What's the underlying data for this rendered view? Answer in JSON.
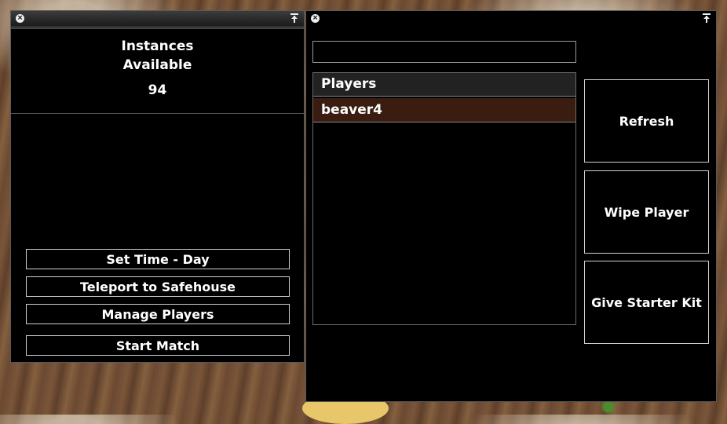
{
  "left_panel": {
    "instances_line1": "Instances",
    "instances_line2": "Available",
    "instances_count": "94",
    "buttons": {
      "set_time": "Set Time - Day",
      "teleport": "Teleport to Safehouse",
      "manage_players": "Manage Players",
      "start_match": "Start Match"
    }
  },
  "right_panel": {
    "search_value": "",
    "players_header": "Players",
    "players": [
      "beaver4"
    ],
    "actions": {
      "refresh": "Refresh",
      "wipe_player": "Wipe Player",
      "give_starter_kit": "Give Starter Kit"
    }
  },
  "icons": {
    "close": "close-icon",
    "pin": "pin-icon"
  },
  "colors": {
    "panel_bg": "#000000",
    "selected_row": "#3a1d10",
    "header_bg": "#222222"
  }
}
